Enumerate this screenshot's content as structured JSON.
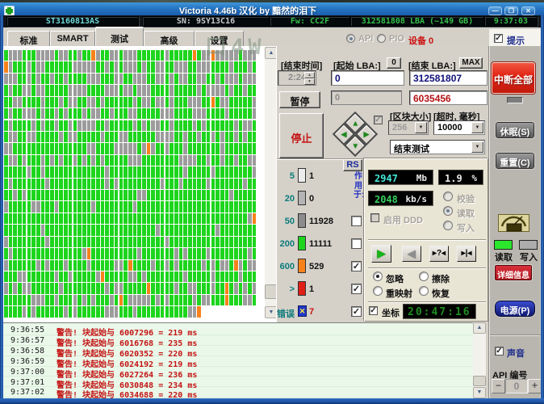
{
  "window": {
    "title": "Victoria 4.46b 汉化 by 黯然的泪下",
    "minimize": "—",
    "maximize": "❐",
    "close": "✕"
  },
  "info_bar": {
    "model": "ST3160813AS",
    "serial": "SN: 9SY13C16",
    "firmware": "Fw: CC2F",
    "capacity": "312581808 LBA (~149 GB)",
    "clock": "9:37:03"
  },
  "tabs": [
    {
      "label": "标准",
      "active": false
    },
    {
      "label": "SMART",
      "active": false
    },
    {
      "label": "测试",
      "active": true
    },
    {
      "label": "高级",
      "active": false
    },
    {
      "label": "设置",
      "active": false
    }
  ],
  "tabbar_right": {
    "api_label": "API",
    "pio_label": "PIO",
    "device_label": "设备 0",
    "hint_label": "提示",
    "hint_checked": true
  },
  "watermark": "口4W",
  "test_controls": {
    "end_time_label": "[结束时间]",
    "end_time_value": "2:24",
    "start_lba_label": "[起始 LBA:]",
    "zero_button": "0",
    "start_lba_value": "0",
    "end_lba_label": "[结束 LBA:]",
    "max_button": "MAX",
    "end_lba_value": "312581807",
    "pause_button": "暂停",
    "current_lba_value": "0",
    "current_block_value": "6035456",
    "stop_button": "停止",
    "block_size_label": "[区块大小]",
    "block_size_value": "256",
    "timeout_label": "[超时, 毫秒]",
    "timeout_value": "10000",
    "after_test_value": "结束测试",
    "rs_button": "RS"
  },
  "legend": {
    "vertical_label": "作用于:",
    "rows": [
      {
        "label": "5",
        "color": "#ececec",
        "count": "1",
        "checkbox": null,
        "count_color": "#111"
      },
      {
        "label": "20",
        "color": "#b4b4b4",
        "count": "0",
        "checkbox": null,
        "count_color": "#111"
      },
      {
        "label": "50",
        "color": "#8c8c8c",
        "count": "11928",
        "checkbox": false,
        "count_color": "#111"
      },
      {
        "label": "200",
        "color": "#1dd51d",
        "count": "11111",
        "checkbox": false,
        "count_color": "#111"
      },
      {
        "label": "600",
        "color": "#f8821a",
        "count": "529",
        "checkbox": true,
        "count_color": "#111"
      },
      {
        "label": ">",
        "color": "#e02016",
        "count": "1",
        "checkbox": true,
        "count_color": "#111"
      },
      {
        "label": "错误",
        "color": "error-icon",
        "count": "7",
        "checkbox": true,
        "count_color": "#cc1111"
      }
    ]
  },
  "readouts": {
    "passed_value": "2947",
    "passed_unit": "Mb",
    "percent_value": "1.9",
    "percent_unit": "%",
    "speed_value": "2048",
    "speed_unit": "kb/s",
    "ddd_label": "启用 DDD",
    "mode_radios": [
      {
        "label": "校验",
        "selected": false
      },
      {
        "label": "读取",
        "selected": true
      },
      {
        "label": "写入",
        "selected": false
      }
    ],
    "action_radios": [
      {
        "label": "忽略",
        "selected": true
      },
      {
        "label": "擦除",
        "selected": false
      },
      {
        "label": "重映射",
        "selected": false
      },
      {
        "label": "恢复",
        "selected": false
      }
    ],
    "coord_label": "坐标",
    "coord_checked": true,
    "lcd_time": "20:47:16"
  },
  "right_panel": {
    "break_all_button": "中断全部",
    "sleep_button": "休眠(S)",
    "reset_button": "重置(C)",
    "read_label": "读取",
    "write_label": "写入",
    "details_button": "详细信息",
    "power_button": "电源(P)",
    "sound_label": "声音",
    "sound_checked": true,
    "api_number_label": "API 编号",
    "api_minus": "−",
    "api_value": "0",
    "api_plus": "+"
  },
  "grid": {
    "colors": {
      "G": "#1dd51d",
      "x": "#9c9c9c",
      "O": "#f8821a"
    },
    "rows": [
      "GxxxGGGxxxxGxxGGxGGOxGGxxGxxxGGGGGGxGGGGGOGxxOxxxxxGxxx",
      "OxGGGxGxxGGGGGGxxxxxGGxGxGxxxGxGGxxGGxxxGGxxxGGGGxGGGxG",
      "xxxGGxGxGGxGGxGGGGxxxGGGxxGGxxxGGxxGxGxxGGxxGGxGxxxGxxx",
      "GxGGxxGxxGGGGGxxxxGGGGxxxGxxGxxxGGGGxGGGGGxGxxxxGxGGxGG",
      "GGxxGGGGxGGGxGxxGGxxGxGGGGGGxGxxGxxGxGGGxxxGGOGxxGGGGGx",
      "GxGGxxxGxGGxGxGGGxGxxGGxGGGxxGGGGGxxxGGGGxxxGGGGxGGGGGx",
      "GxGGGGxGxGGxGGxGxxxxGGxGGGGGxGxGxxGGxGGGGxGxGGGGGGxGxxG",
      "GxxGGxxGGGGGxGxxGGGGGxGGGxxGGGGGGxxxxGGxGGxGGxGxGGxGxGG",
      "xxGGGGGGGGGGGGGGGGxxGGGGxxxxxGxOxGGxGGGxGGGGGGGxGGGGGGG",
      "GxxGxGGGxGxGxGGxGxGxGxGGGGGxxxGGGGGGGGxxxxGGxGGxGGxGGxx",
      "GGGGGxGGxGGGGGGGGGGGGGxGGGGGGGGGGGGGGGGxGGGGGxGGGGGGGGx",
      "GxGGGGGGGxGGGGGGGGGGGGxGxGGGGGGGGGxGGGxGGGGGxGGGGGGGxGG",
      "GGxGxGGGGGGGGGGGGGGGGGGGGGGGGxxGGGGGGGGGGGGGGGGGGxGGGGG",
      "xGGGGGxxGGGxGGGGGGGxGGGGGGGGxGGGGGGGGGGGGGGGGGGGGGGGGGG",
      "GGGGGGGGGGGGGGGGGGGGGGGGGGGGGGGGGGGGGGGGGGGGGGGGGGGGGxO",
      "GGGGGGGGxGGGGGGGGGGGGGGGGGGGGGGGGxGGGGGGGGGGGGxGGGGGGGG",
      "xGGGGGGGGxGGGGGGGGGGGGGGGGGGGGGGGGGxGGGGGGGGGGGGGGGGGGG",
      "GxGGGGGGGGGGGGGGGxOGGGGGGGGGGxGGGGGGGxGxGGGGxGGGGGGGGxG",
      "xGGGGGGxGxGGGxGGGGxGGGGGxxGOGGGGxGGxGxGGGGGxGxGxxGOxGxx",
      "GGGxxGGGGGGxGGxGGGGGxOGGGGGxxGxGGGGGGGGxGGGGGxGGGGGxGGG",
      "xGxGxxGGGGGGxGGGGGGGGGxGxxGGGGGOGGGGGxGGxxGGGxGGOGxGxGx",
      "GGGGGGxxxGGxGGGxGxGxGGGxGOGxxxxxGxGxGGGGGxGxxGGGOGGGxxG",
      "GGGGxGxGGGGGGxGxGGGGGGxxxGGGxGGGGGGGGGGGxxO............"
    ]
  },
  "log": {
    "lines": [
      {
        "time": "9:36:55",
        "message": "警告! 块起始与 6007296 = 219 ms"
      },
      {
        "time": "9:36:57",
        "message": "警告! 块起始与 6016768 = 235 ms"
      },
      {
        "time": "9:36:58",
        "message": "警告! 块起始与 6020352 = 220 ms"
      },
      {
        "time": "9:36:59",
        "message": "警告! 块起始与 6024192 = 219 ms"
      },
      {
        "time": "9:37:00",
        "message": "警告! 块起始与 6027264 = 236 ms"
      },
      {
        "time": "9:37:01",
        "message": "警告! 块起始与 6030848 = 234 ms"
      },
      {
        "time": "9:37:02",
        "message": "警告! 块起始与 6034688 = 220 ms"
      }
    ]
  }
}
